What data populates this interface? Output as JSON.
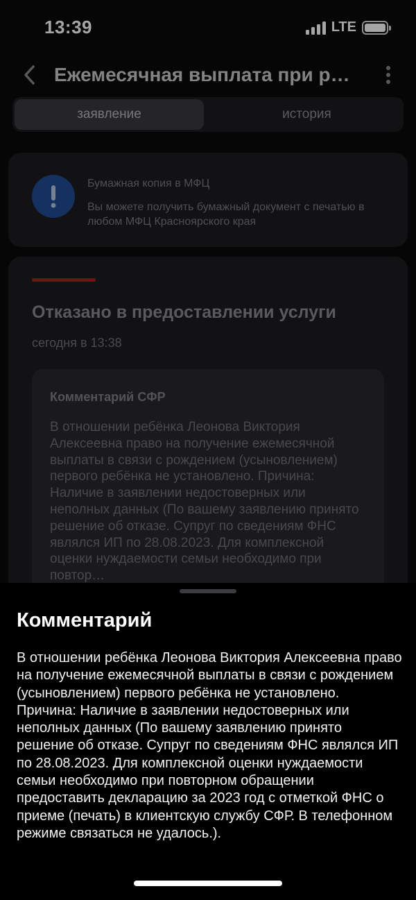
{
  "status_bar": {
    "time": "13:39",
    "network": "LTE",
    "icons": [
      "signal-bars-icon",
      "battery-icon"
    ]
  },
  "header": {
    "title": "Ежемесячная выплата при рождении (усыновлении) первого ребёнка",
    "back_icon": "chevron-left-icon",
    "menu_icon": "more-vertical-icon"
  },
  "tabs": [
    {
      "label": "заявление",
      "active": true
    },
    {
      "label": "история",
      "active": false
    }
  ],
  "info_card": {
    "icon": "exclamation-icon",
    "icon_color": "#1f4c94",
    "title": "Бумажная копия в МФЦ",
    "text": "Вы можете получить бумажный документ с печатью в любом МФЦ Красноярского края"
  },
  "status_card": {
    "accent_color": "#a8201f",
    "title": "Отказано в предоставлении услуги",
    "date": "сегодня в 13:38",
    "comment_title": "Комментарий СФР",
    "comment_preview": "В отношении ребёнка Леонова Виктория Алексеевна право на получение ежемесячной выплаты в связи с рождением (усыновлением) первого ребёнка не установлено. Причина: Наличие в заявлении недостоверных или неполных данных (По вашему заявлению принято решение об отказе. Супруг по сведениям ФНС являлся ИП по 28.08.2023. Для комплексной оценки нуждаемости семьи необходимо при повтор…"
  },
  "sheet": {
    "title": "Комментарий",
    "text": "В отношении ребёнка Леонова Виктория Алексеевна право на получение ежемесячной выплаты в связи с рождением (усыновлением) первого ребёнка не установлено. Причина: Наличие в заявлении недостоверных или неполных данных (По вашему заявлению принято решение об отказе. Супруг по сведениям ФНС являлся ИП по 28.08.2023. Для комплексной оценки нуждаемости семьи необходимо при повторном обращении предоставить декларацию за 2023 год с отметкой ФНС о приеме (печать) в клиентскую службу СФР. В телефонном режиме связаться не удалось.)."
  }
}
